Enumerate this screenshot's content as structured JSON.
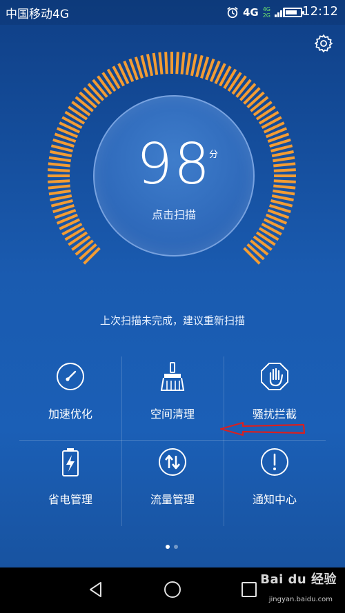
{
  "status_bar": {
    "carrier": "中国移动4G",
    "network_label": "4G",
    "mini_top": "4G",
    "mini_bottom": "2G",
    "time": "12:12",
    "battery_level": 0.8
  },
  "header": {
    "settings_icon": "gear-icon"
  },
  "scan_gauge": {
    "score": "98",
    "score_unit": "分",
    "button_label": "点击扫描",
    "arc_color": "#f39c33"
  },
  "hint_text": "上次扫描未完成，建议重新扫描",
  "features": [
    {
      "label": "加速优化",
      "icon": "speedometer-icon"
    },
    {
      "label": "空间清理",
      "icon": "broom-icon"
    },
    {
      "label": "骚扰拦截",
      "icon": "stop-hand-icon"
    },
    {
      "label": "省电管理",
      "icon": "battery-charge-icon"
    },
    {
      "label": "流量管理",
      "icon": "data-arrows-icon"
    },
    {
      "label": "通知中心",
      "icon": "exclamation-icon"
    }
  ],
  "page_indicator": {
    "active": 1,
    "total": 2
  },
  "annotation": {
    "color": "#d82020"
  },
  "nav_bar": {
    "back": "back-icon",
    "home": "home-icon",
    "recents": "recents-icon"
  },
  "watermark": {
    "brand": "Bai du 经验",
    "url": "jingyan.baidu.com"
  }
}
